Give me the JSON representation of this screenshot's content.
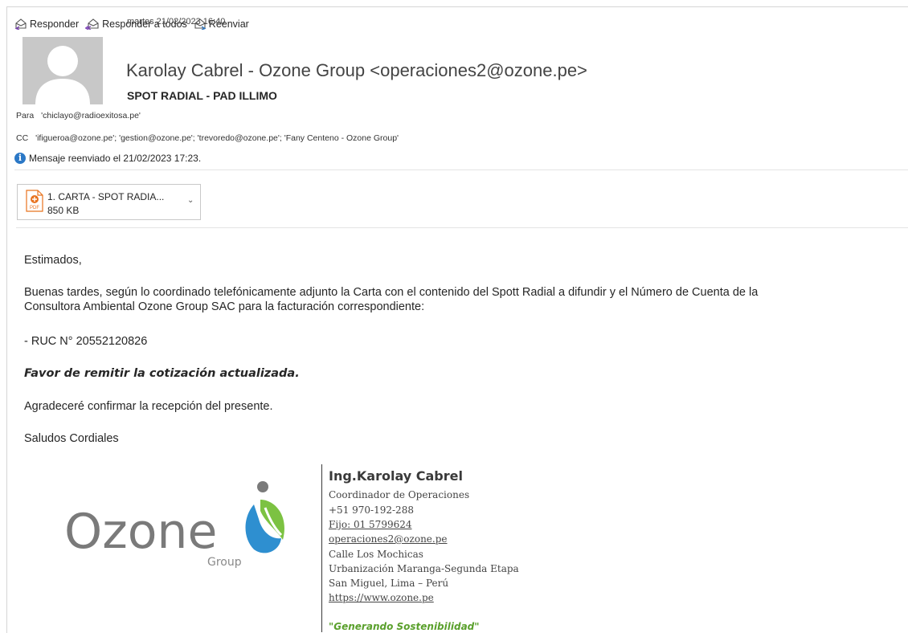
{
  "toolbar": {
    "reply": "Responder",
    "reply_all": "Responder a todos",
    "forward": "Reenviar"
  },
  "message": {
    "date": "martes 21/02/2023 16:40",
    "sender": "Karolay Cabrel - Ozone Group <operaciones2@ozone.pe>",
    "subject": "SPOT RADIAL - PAD ILLIMO",
    "to_label": "Para",
    "to": "'chiclayo@radioexitosa.pe'",
    "cc_label": "CC",
    "cc": "'ifigueroa@ozone.pe'; 'gestion@ozone.pe'; 'trevoredo@ozone.pe'; 'Fany Centeno - Ozone Group'",
    "forwarded_note": "Mensaje reenviado el 21/02/2023 17:23."
  },
  "attachment": {
    "name": "1. CARTA - SPOT RADIA...",
    "size": "850 KB",
    "type_label": "PDF"
  },
  "body": {
    "greeting": "Estimados,",
    "paragraph_line1": "Buenas tardes, según lo coordinado telefónicamente adjunto la Carta con el contenido del Spott Radial a difundir y el  Número de Cuenta de la",
    "paragraph_line2": "Consultora Ambiental Ozone Group SAC para la facturación correspondiente:",
    "ruc": "- RUC N° 20552120826",
    "emphasis": "Favor de remitir la cotización actualizada.",
    "confirm": "Agradeceré confirmar la recepción del presente.",
    "closing": "Saludos Cordiales"
  },
  "logo": {
    "word": "Ozone",
    "sub": "Group"
  },
  "signature": {
    "name": "Ing.Karolay Cabrel",
    "title": "Coordinador de Operaciones",
    "phone": "+51 970-192-288",
    "landline": "Fijo: 01 5799624",
    "email": "operaciones2@ozone.pe",
    "address1": "Calle Los Mochicas",
    "address2": "Urbanización Maranga-Segunda Etapa",
    "city": "San Miguel, Lima – Perú",
    "website": "https://www.ozone.pe",
    "slogan": "\"Generando Sostenibilidad\""
  },
  "colors": {
    "info_blue": "#2b78c6",
    "pdf_orange": "#e8731f",
    "slogan_green": "#5aa02c",
    "logo_gray": "#7a7a7a",
    "logo_blue": "#2e8fd0",
    "logo_green": "#7cc242"
  },
  "icons": [
    "reply-icon",
    "reply-all-icon",
    "forward-icon",
    "info-icon",
    "pdf-icon",
    "chevron-down-icon",
    "avatar-icon"
  ]
}
